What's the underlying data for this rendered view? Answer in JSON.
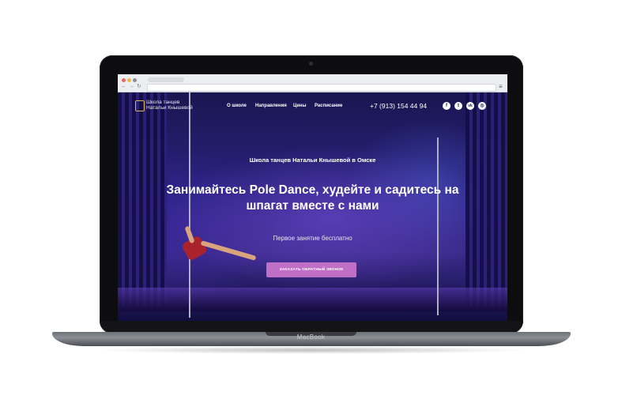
{
  "device": {
    "model_label": "MacBook"
  },
  "site": {
    "logo_text_line1": "Школа танцев",
    "logo_text_line2": "Натальи Кнышевой",
    "menu": [
      {
        "label": "О школе"
      },
      {
        "label": "Направления"
      },
      {
        "label": "Цены"
      },
      {
        "label": "Расписание"
      }
    ],
    "phone": "+7 (913) 154 44 94",
    "social_icons": [
      "facebook-icon",
      "twitter-icon",
      "vk-icon",
      "instagram-icon"
    ],
    "social_glyphs": [
      "f",
      "t",
      "vk",
      "◎"
    ]
  },
  "hero": {
    "subtitle": "Школа танцев Натальи Кнышевой в Омске",
    "headline": "Занимайтесь Pole Dance, худейте и садитесь на шпагат вместе с нами",
    "offer": "Первое занятие бесплатно",
    "cta_label": "Заказать обратный звонок"
  },
  "colors": {
    "cta": "#c06fc7",
    "hero_background": "#2b2280",
    "window_dots": [
      "#e86a5e",
      "#e9b94b",
      "#8a8f96"
    ]
  }
}
